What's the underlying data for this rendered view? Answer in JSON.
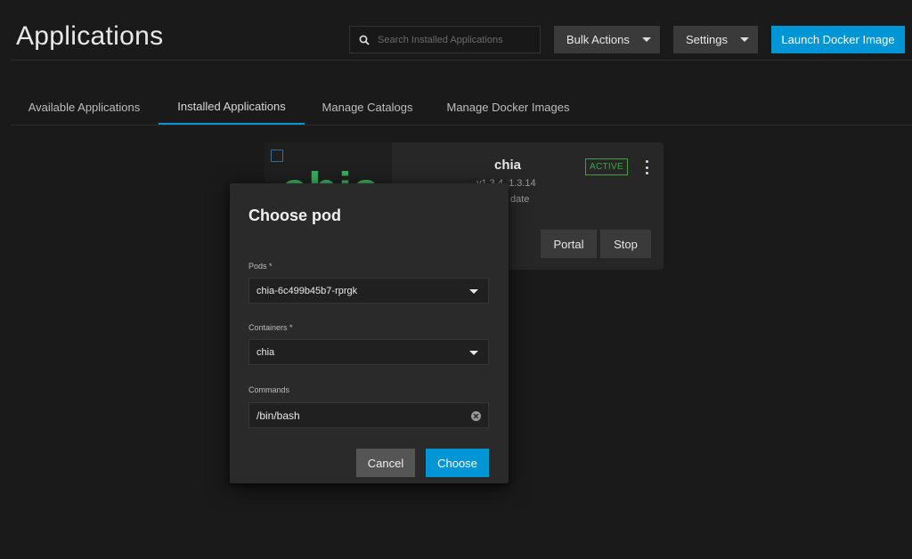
{
  "header": {
    "title": "Applications",
    "search_placeholder": "Search Installed Applications",
    "bulk_actions_label": "Bulk Actions",
    "settings_label": "Settings",
    "launch_docker_label": "Launch Docker Image"
  },
  "tabs": [
    {
      "label": "Available Applications",
      "active": false
    },
    {
      "label": "Installed Applications",
      "active": true
    },
    {
      "label": "Manage Catalogs",
      "active": false
    },
    {
      "label": "Manage Docker Images",
      "active": false
    }
  ],
  "app_card": {
    "logo_text": "chia",
    "name": "chia",
    "version": "v1.3.4_1.3.14",
    "update_status": "date",
    "status": "ACTIVE",
    "portal_label": "Portal",
    "stop_label": "Stop"
  },
  "dialog": {
    "title": "Choose pod",
    "pods_label": "Pods *",
    "pods_value": "chia-6c499b45b7-rprgk",
    "containers_label": "Containers *",
    "containers_value": "chia",
    "commands_label": "Commands",
    "commands_value": "/bin/bash",
    "cancel_label": "Cancel",
    "choose_label": "Choose"
  },
  "colors": {
    "accent": "#0095d5",
    "background": "#1a1a1a",
    "active_status": "#3fa242",
    "brand_logo": "#3aac59"
  },
  "icons": {
    "search": "search-icon",
    "caret": "caret-down-icon",
    "kebab": "more-vert-icon",
    "clear": "clear-icon"
  }
}
